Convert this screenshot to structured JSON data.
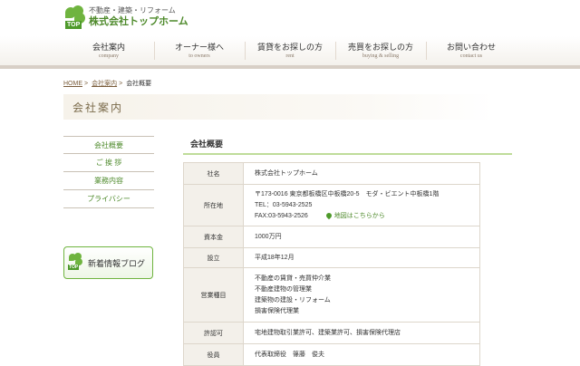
{
  "header": {
    "logo_tagline": "不動産・建築・リフォーム",
    "logo_name": "株式会社トップホーム",
    "logo_badge": "TOP"
  },
  "nav": {
    "items": [
      {
        "label": "会社案内",
        "sub": "company"
      },
      {
        "label": "オーナー様へ",
        "sub": "to owners"
      },
      {
        "label": "賃貸をお探しの方",
        "sub": "rent"
      },
      {
        "label": "売買をお探しの方",
        "sub": "buying & selling"
      },
      {
        "label": "お問い合わせ",
        "sub": "contact us"
      }
    ]
  },
  "breadcrumb": {
    "home": "HOME",
    "company": "会社案内",
    "current": "会社概要",
    "sep": ">"
  },
  "page_title": "会社案内",
  "sidebar": {
    "items": [
      "会社概要",
      "ご 挨 拶",
      "業務内容",
      "プライバシー"
    ]
  },
  "blog_banner": {
    "label": "新着情報ブログ",
    "badge": "TOP"
  },
  "section_title": "会社概要",
  "profile": {
    "name_label": "社名",
    "name_value": "株式会社トップホーム",
    "address_label": "所在地",
    "address_line": "〒173-0016 東京都板橋区中板橋20-5　モダ・ビエント中板橋1階",
    "tel": "TEL：03-5943-2525",
    "fax": "FAX:03-5943-2526",
    "map_link": "地図はこちらから",
    "capital_label": "資本金",
    "capital_value": "1000万円",
    "founded_label": "設立",
    "founded_value": "平成18年12月",
    "business_label": "営業種目",
    "business_lines": [
      "不動産の賃貸・売買仲介業",
      "不動産建物の管理業",
      "建築物の建設・リフォーム",
      "損害保険代理業"
    ],
    "license_label": "許認可",
    "license_value": "宅地建物取引業許可、建築業許可、損害保険代理店",
    "officers_label": "役員",
    "officers_value": "代表取締役　篠藤　俊夫"
  }
}
